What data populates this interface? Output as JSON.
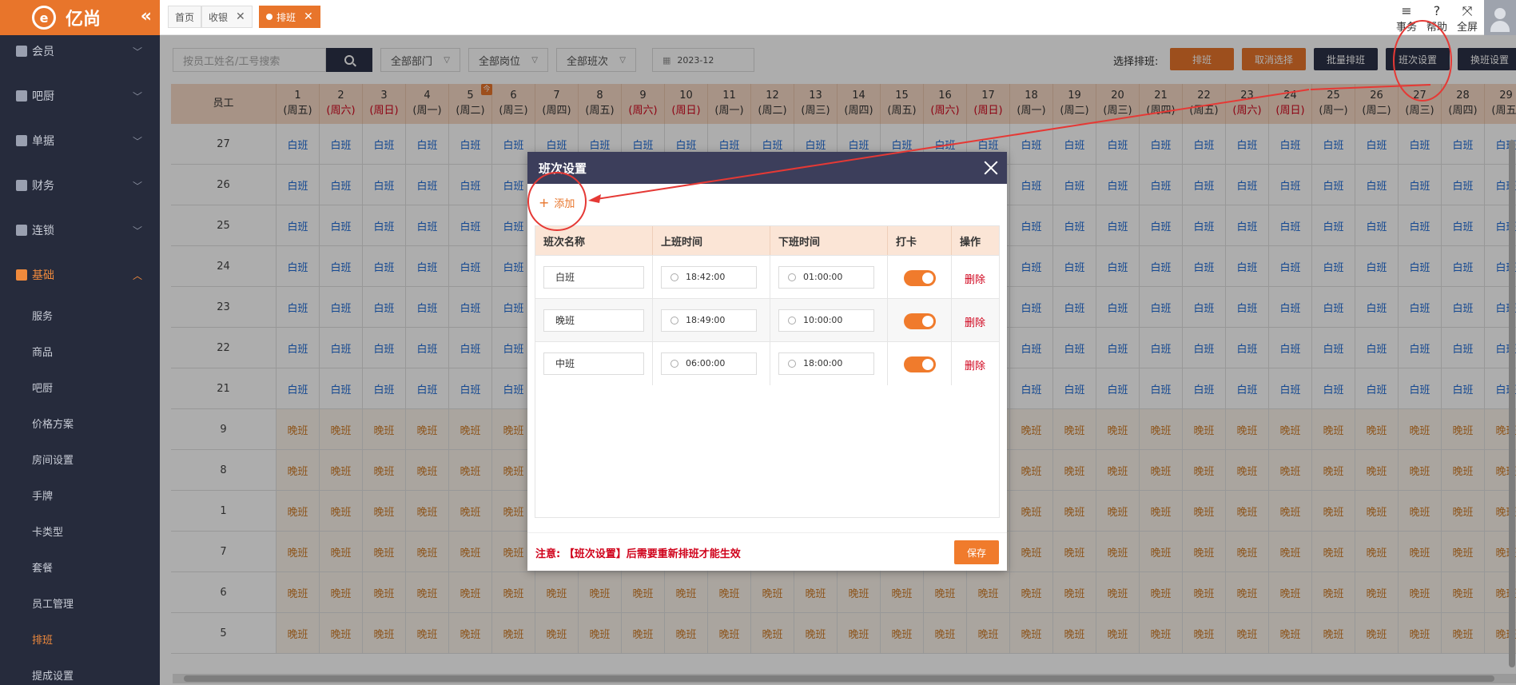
{
  "brand": {
    "logo_glyph": "e",
    "name": "亿尚",
    "collapse_icon": "«"
  },
  "sidebar": {
    "groups": [
      {
        "label": "会员"
      },
      {
        "label": "吧厨"
      },
      {
        "label": "单据"
      },
      {
        "label": "财务"
      },
      {
        "label": "连锁"
      },
      {
        "label": "基础"
      }
    ],
    "subitems": [
      {
        "label": "服务"
      },
      {
        "label": "商品"
      },
      {
        "label": "吧厨"
      },
      {
        "label": "价格方案"
      },
      {
        "label": "房间设置"
      },
      {
        "label": "手牌"
      },
      {
        "label": "卡类型"
      },
      {
        "label": "套餐"
      },
      {
        "label": "员工管理"
      },
      {
        "label": "排班"
      },
      {
        "label": "提成设置"
      }
    ],
    "active_color": "#f08a3c"
  },
  "tabs": [
    {
      "label": "首页"
    },
    {
      "label": "收银",
      "close": "✕"
    },
    {
      "label": "排班",
      "close": "✕"
    }
  ],
  "tools": [
    {
      "glyph": "≡",
      "label": "事务"
    },
    {
      "glyph": "?",
      "label": "帮助"
    },
    {
      "glyph": "⤧",
      "label": "全屏"
    }
  ],
  "filters": {
    "search_placeholder": "按员工姓名/工号搜索",
    "dept": "全部部门",
    "post": "全部岗位",
    "shift": "全部班次",
    "month": "2023-12"
  },
  "actions": {
    "select_label": "选择排班:",
    "schedule": "排班",
    "cancel_select": "取消选择",
    "batch": "批量排班",
    "shift_settings": "班次设置",
    "swap_settings": "换班设置"
  },
  "grid": {
    "employee_header": "员工",
    "today_badge": "今",
    "days": [
      {
        "d": "1",
        "w": "(周五)"
      },
      {
        "d": "2",
        "w": "(周六)"
      },
      {
        "d": "3",
        "w": "(周日)"
      },
      {
        "d": "4",
        "w": "(周一)"
      },
      {
        "d": "5",
        "w": "(周二)"
      },
      {
        "d": "6",
        "w": "(周三)"
      },
      {
        "d": "7",
        "w": "(周四)"
      },
      {
        "d": "8",
        "w": "(周五)"
      },
      {
        "d": "9",
        "w": "(周六)"
      },
      {
        "d": "10",
        "w": "(周日)"
      },
      {
        "d": "11",
        "w": "(周一)"
      },
      {
        "d": "12",
        "w": "(周二)"
      },
      {
        "d": "13",
        "w": "(周三)"
      },
      {
        "d": "14",
        "w": "(周四)"
      },
      {
        "d": "15",
        "w": "(周五)"
      },
      {
        "d": "16",
        "w": "(周六)"
      },
      {
        "d": "17",
        "w": "(周日)"
      },
      {
        "d": "18",
        "w": "(周一)"
      },
      {
        "d": "19",
        "w": "(周二)"
      },
      {
        "d": "20",
        "w": "(周三)"
      },
      {
        "d": "21",
        "w": "(周四)"
      },
      {
        "d": "22",
        "w": "(周五)"
      },
      {
        "d": "23",
        "w": "(周六)"
      },
      {
        "d": "24",
        "w": "(周日)"
      },
      {
        "d": "25",
        "w": "(周一)"
      },
      {
        "d": "26",
        "w": "(周二)"
      },
      {
        "d": "27",
        "w": "(周三)"
      },
      {
        "d": "28",
        "w": "(周四)"
      },
      {
        "d": "29",
        "w": "(周五)"
      }
    ],
    "weekend_color": "#d0021b",
    "rows": [
      {
        "emp": "27",
        "shift": "白班"
      },
      {
        "emp": "26",
        "shift": "白班"
      },
      {
        "emp": "25",
        "shift": "白班"
      },
      {
        "emp": "24",
        "shift": "白班"
      },
      {
        "emp": "23",
        "shift": "白班"
      },
      {
        "emp": "22",
        "shift": "白班"
      },
      {
        "emp": "21",
        "shift": "白班"
      },
      {
        "emp": "9",
        "shift": "晚班"
      },
      {
        "emp": "8",
        "shift": "晚班"
      },
      {
        "emp": "1",
        "shift": "晚班"
      },
      {
        "emp": "7",
        "shift": "晚班"
      },
      {
        "emp": "6",
        "shift": "晚班"
      },
      {
        "emp": "5",
        "shift": "晚班"
      }
    ]
  },
  "modal": {
    "title": "班次设置",
    "add_label": "添加",
    "headers": {
      "name": "班次名称",
      "start": "上班时间",
      "end": "下班时间",
      "punch": "打卡",
      "op": "操作"
    },
    "shifts": [
      {
        "name": "白班",
        "start": "18:42:00",
        "end": "01:00:00",
        "punch": true,
        "delete": "删除"
      },
      {
        "name": "晚班",
        "start": "18:49:00",
        "end": "10:00:00",
        "punch": true,
        "delete": "删除"
      },
      {
        "name": "中班",
        "start": "06:00:00",
        "end": "18:00:00",
        "punch": true,
        "delete": "删除"
      }
    ],
    "notice": "注意: 【班次设置】后需要重新排班才能生效",
    "save_label": "保存"
  },
  "colors": {
    "accent": "#e8752b",
    "sidebar": "#262b3c",
    "modal_head": "#3c3e5b",
    "annotation": "#e53935"
  }
}
